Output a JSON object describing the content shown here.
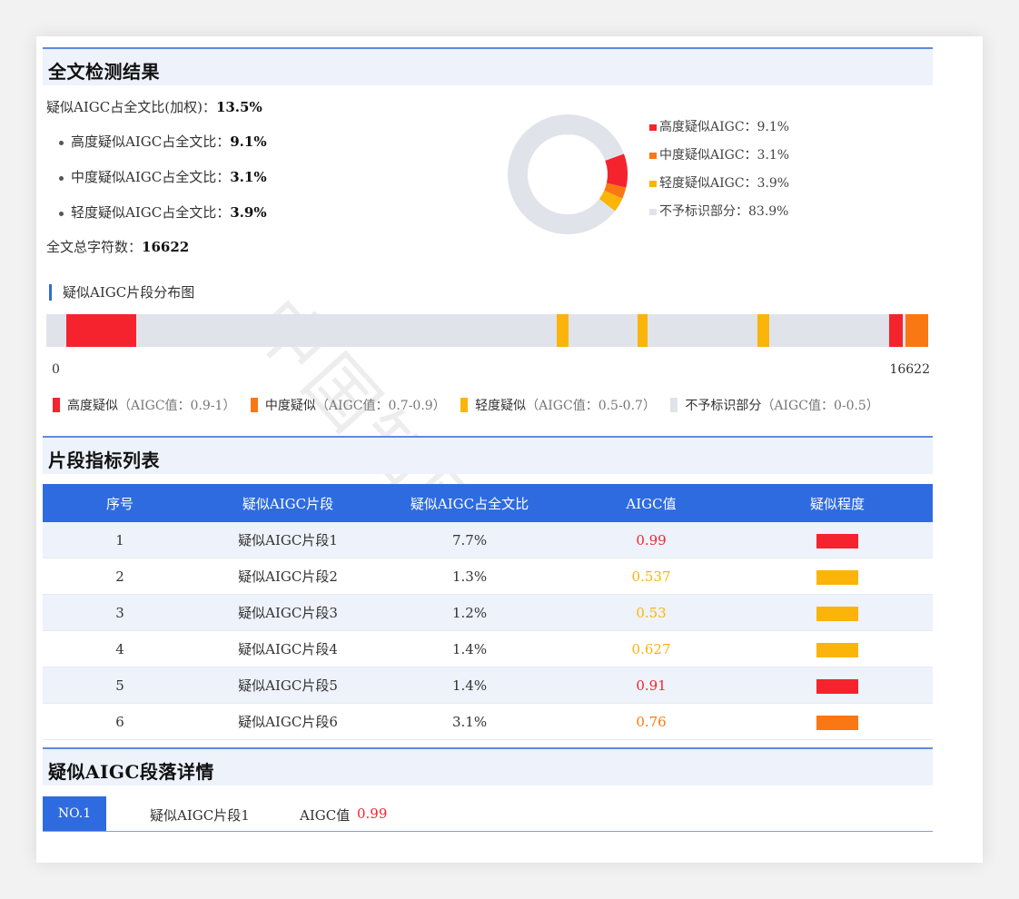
{
  "colors": {
    "high": "#f5232e",
    "medium": "#fa7813",
    "low": "#fbb40a",
    "none": "#e0e4ea",
    "accent": "#2f6be0"
  },
  "summary": {
    "section_title": "全文检测结果",
    "weighted_label": "疑似AIGC占全文比(加权)：",
    "weighted_value": "13.5%",
    "high_label": "高度疑似AIGC占全文比：",
    "high_value": "9.1%",
    "medium_label": "中度疑似AIGC占全文比：",
    "medium_value": "3.1%",
    "low_label": "轻度疑似AIGC占全文比：",
    "low_value": "3.9%",
    "total_label": "全文总字符数：",
    "total_value": "16622"
  },
  "chart_data": {
    "type": "pie",
    "categories": [
      "高度疑似AIGC",
      "中度疑似AIGC",
      "轻度疑似AIGC",
      "不予标识部分"
    ],
    "values": [
      9.1,
      3.1,
      3.9,
      83.9
    ],
    "legend": [
      {
        "label": "高度疑似AIGC：",
        "value": "9.1%",
        "color": "#f5232e"
      },
      {
        "label": "中度疑似AIGC：",
        "value": "3.1%",
        "color": "#fa7813"
      },
      {
        "label": "轻度疑似AIGC：",
        "value": "3.9%",
        "color": "#fbb40a"
      },
      {
        "label": "不予标识部分：",
        "value": "83.9%",
        "color": "#e0e4ea"
      }
    ]
  },
  "distribution": {
    "title": "疑似AIGC片段分布图",
    "start_label": "0",
    "end_label": "16622",
    "total": 16622,
    "segments": [
      {
        "start": 380,
        "end": 1700,
        "level": "high"
      },
      {
        "start": 9620,
        "end": 9850,
        "level": "low"
      },
      {
        "start": 11140,
        "end": 11340,
        "level": "low"
      },
      {
        "start": 13400,
        "end": 13620,
        "level": "low"
      },
      {
        "start": 15890,
        "end": 16150,
        "level": "high"
      },
      {
        "start": 16190,
        "end": 16622,
        "level": "medium"
      }
    ],
    "legend": [
      {
        "name": "高度疑似",
        "range": "（AIGC值：0.9-1）",
        "color": "#f5232e"
      },
      {
        "name": "中度疑似",
        "range": "（AIGC值：0.7-0.9）",
        "color": "#fa7813"
      },
      {
        "name": "轻度疑似",
        "range": "（AIGC值：0.5-0.7）",
        "color": "#fbb40a"
      },
      {
        "name": "不予标识部分",
        "range": "（AIGC值：0-0.5）",
        "color": "#e0e4ea"
      }
    ]
  },
  "fragments": {
    "section_title": "片段指标列表",
    "columns": [
      "序号",
      "疑似AIGC片段",
      "疑似AIGC占全文比",
      "AIGC值",
      "疑似程度"
    ],
    "rows": [
      {
        "no": "1",
        "name": "疑似AIGC片段1",
        "ratio": "7.7%",
        "value": "0.99",
        "color": "#f5232e"
      },
      {
        "no": "2",
        "name": "疑似AIGC片段2",
        "ratio": "1.3%",
        "value": "0.537",
        "color": "#fbb40a"
      },
      {
        "no": "3",
        "name": "疑似AIGC片段3",
        "ratio": "1.2%",
        "value": "0.53",
        "color": "#fbb40a"
      },
      {
        "no": "4",
        "name": "疑似AIGC片段4",
        "ratio": "1.4%",
        "value": "0.627",
        "color": "#fbb40a"
      },
      {
        "no": "5",
        "name": "疑似AIGC片段5",
        "ratio": "1.4%",
        "value": "0.91",
        "color": "#f5232e"
      },
      {
        "no": "6",
        "name": "疑似AIGC片段6",
        "ratio": "3.1%",
        "value": "0.76",
        "color": "#fa7813"
      }
    ]
  },
  "details": {
    "section_title": "疑似AIGC段落详情",
    "tab_label": "NO.1",
    "fragment_name": "疑似AIGC片段1",
    "value_label": "AIGC值",
    "value": "0.99"
  },
  "watermark": "中国知网"
}
